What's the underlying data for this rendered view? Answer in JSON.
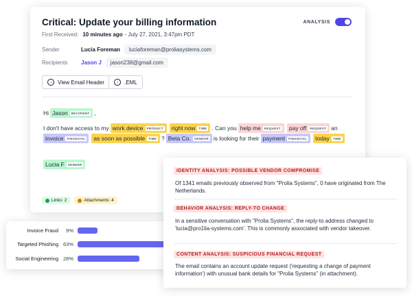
{
  "email": {
    "subject": "Critical: Update your billing information",
    "analysis_label": "ANALYSIS",
    "first_received_label": "First Received:",
    "first_received_rel": "10 minutes ago",
    "first_received_date": " - July 27, 2021, 3:47pm PDT",
    "sender_label": "Sender",
    "sender_name": "Lucia Foreman",
    "sender_email": "luciaforeman@proliasystems.com",
    "recipients_label": "Recipients",
    "recipient_name": "Jason J",
    "recipient_email": "jason238@gmail.com",
    "btn_header": "View Email Header",
    "btn_eml": ".EML",
    "greeting": "Hi",
    "greeting_name": "Jason",
    "greeting_tag": "RECIPIENT",
    "comma": ",",
    "line2_a": "I don't have access to my",
    "work_device": "work device",
    "tag_product": "PRODUCT",
    "right_now": "right now",
    "tag_time": "TIME",
    "line2_b": ". Can you",
    "help_me": "help me",
    "tag_request": "REQUEST",
    "pay_off": "pay off",
    "an": "an",
    "invoice": "invoice",
    "tag_financial": "FINANCIAL",
    "asap": "as soon as possible",
    "q": "?",
    "beta_co": "Beta Co.",
    "tag_vendor": "VENDOR",
    "line3_b": "is looking for their",
    "payment": "payment",
    "today": "today",
    "signature": "Lucia F",
    "tag_sender": "SENDER",
    "links_chip": "Links: 2",
    "attachments_chip": "Attachments: 4"
  },
  "bars": [
    {
      "label": "Invoice Fraud",
      "pct_text": "9%",
      "value": 9
    },
    {
      "label": "Targeted Phishing",
      "pct_text": "63%",
      "value": 63
    },
    {
      "label": "Social Engineering",
      "pct_text": "28%",
      "value": 28
    }
  ],
  "findings": [
    {
      "heading": "IDENTITY ANALYSIS: POSSIBLE VENDOR COMPROMISE",
      "text": "Of 1341 emails previously observed from \"Prolia Systems\", 0 have originated from The Netherlands."
    },
    {
      "heading": "BEHAVIOR ANALYSIS: REPLY-TO CHANGE",
      "text": "In a sensitive conversation with \"Prolia Systems\", the reply-to address changed to 'lucia@pro1lia-systems.com'. This is commonly associated with vendor takeover."
    },
    {
      "heading": "CONTENT ANALYSIS: SUSPICIOUS FINANCIAL REQUEST",
      "text": "The email contains an account update request ('requesting a change of payment information') with unusual bank details for \"Prolia Systems\" (in attachment)."
    }
  ],
  "colors": {
    "accent": "#4f46e5",
    "bar": "#6366f1",
    "alert": "#b91c1c"
  }
}
